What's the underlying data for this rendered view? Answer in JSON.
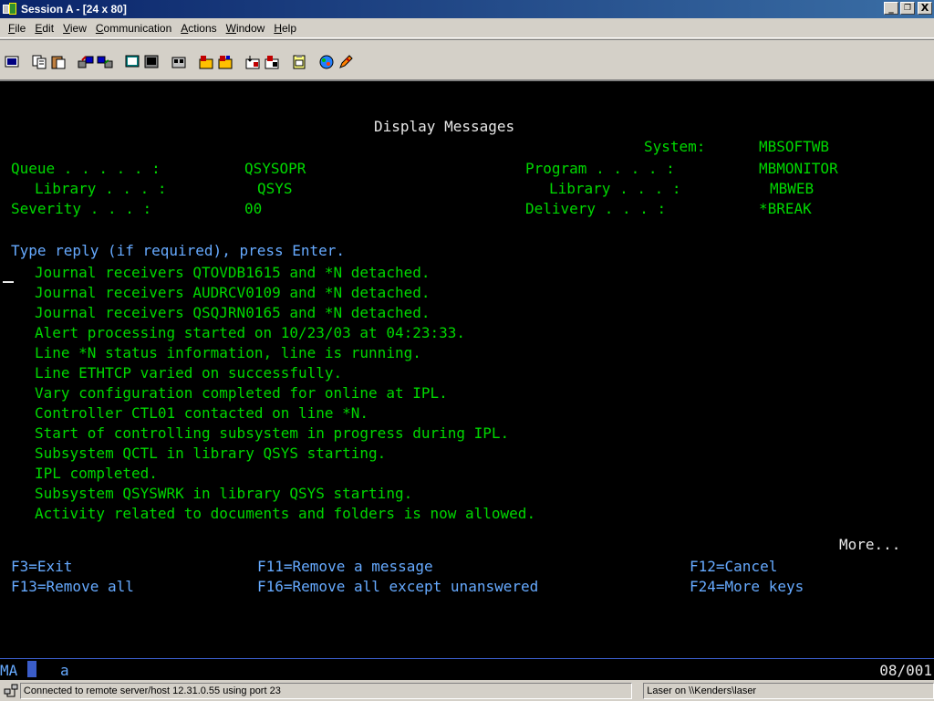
{
  "window": {
    "title": "Session A - [24 x 80]",
    "minimize": "_",
    "restore": "ᗡ",
    "close": "X"
  },
  "menu": [
    {
      "label": "File",
      "key": "F"
    },
    {
      "label": "Edit",
      "key": "E"
    },
    {
      "label": "View",
      "key": "V"
    },
    {
      "label": "Communication",
      "key": "C"
    },
    {
      "label": "Actions",
      "key": "A"
    },
    {
      "label": "Window",
      "key": "W"
    },
    {
      "label": "Help",
      "key": "H"
    }
  ],
  "toolbar_icons": [
    "print-screen-icon",
    "copy-icon",
    "paste-icon",
    "send-file-icon",
    "receive-file-icon",
    "display-icon",
    "macro-icon",
    "record-macro-icon",
    "stop-icon",
    "play-icon",
    "keyboard-map-icon",
    "popup-keypad-icon",
    "clipboard-icon",
    "color-palette-icon",
    "edit-icon"
  ],
  "screen": {
    "heading": "Display Messages",
    "system_label": "System:",
    "system_value": "MBSOFTWB",
    "queue_label": "Queue . . . . . :",
    "queue_value": "QSYSOPR",
    "queue_library_label": "Library . . . :",
    "queue_library_value": "QSYS",
    "severity_label": "Severity . . . :",
    "severity_value": "00",
    "program_label": "Program . . . . :",
    "program_value": "MBMONITOR",
    "program_library_label": "Library . . . :",
    "program_library_value": "MBWEB",
    "delivery_label": "Delivery . . . :",
    "delivery_value": "*BREAK",
    "instruction": "Type reply (if required), press Enter.",
    "messages": [
      "Journal receivers QTOVDB1615 and *N detached.",
      "Journal receivers AUDRCV0109 and *N detached.",
      "Journal receivers QSQJRN0165 and *N detached.",
      "Alert processing started on 10/23/03 at 04:23:33.",
      "Line *N status information, line is running.",
      "Line ETHTCP varied on successfully.",
      "Vary configuration completed for online at IPL.",
      "Controller CTL01 contacted on line *N.",
      "Start of controlling subsystem in progress during IPL.",
      "Subsystem QCTL in library QSYS starting.",
      "IPL completed.",
      "Subsystem QSYSWRK in library QSYS starting.",
      "Activity related to documents and folders is now allowed."
    ],
    "more": "More...",
    "fkeys": {
      "f3": "F3=Exit",
      "f11": "F11=Remove a message",
      "f12": "F12=Cancel",
      "f13": "F13=Remove all",
      "f16": "F16=Remove all except unanswered",
      "f24": "F24=More keys"
    }
  },
  "oia": {
    "indicator": "MA",
    "input_char": "a",
    "cursor_position": "08/001"
  },
  "status": {
    "connection": "Connected to remote server/host 12.31.0.55 using port 23",
    "printer": "Laser on \\\\Kenders\\laser"
  }
}
